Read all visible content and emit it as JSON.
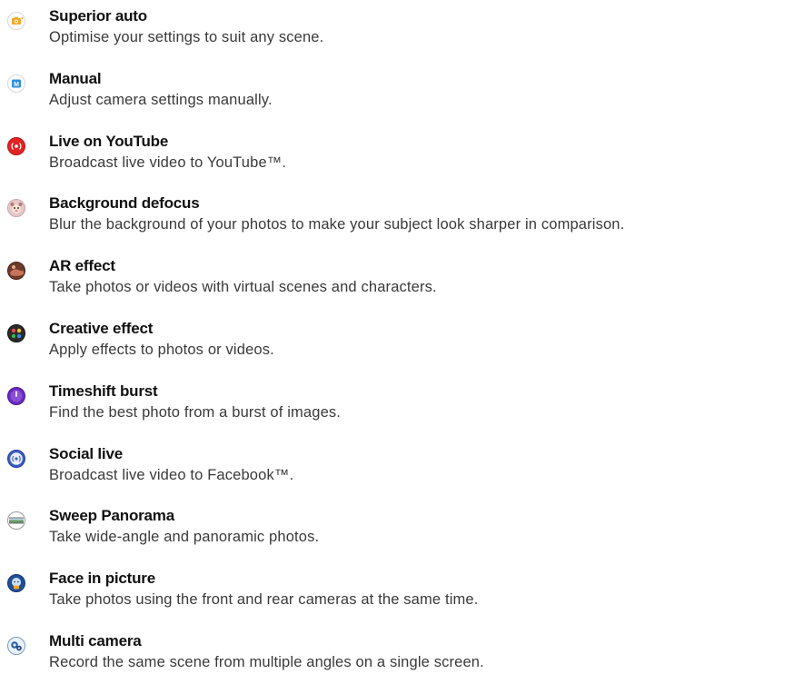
{
  "modes": [
    {
      "title": "Superior auto",
      "description": "Optimise your settings to suit any scene.",
      "icon": "superior-auto-icon"
    },
    {
      "title": "Manual",
      "description": "Adjust camera settings manually.",
      "icon": "manual-icon"
    },
    {
      "title": "Live on YouTube",
      "description": "Broadcast live video to YouTube™.",
      "icon": "youtube-live-icon"
    },
    {
      "title": "Background defocus",
      "description": "Blur the background of your photos to make your subject look sharper in comparison.",
      "icon": "background-defocus-icon"
    },
    {
      "title": "AR effect",
      "description": "Take photos or videos with virtual scenes and characters.",
      "icon": "ar-effect-icon"
    },
    {
      "title": "Creative effect",
      "description": "Apply effects to photos or videos.",
      "icon": "creative-effect-icon"
    },
    {
      "title": "Timeshift burst",
      "description": "Find the best photo from a burst of images.",
      "icon": "timeshift-burst-icon"
    },
    {
      "title": "Social live",
      "description": "Broadcast live video to Facebook™.",
      "icon": "social-live-icon"
    },
    {
      "title": "Sweep Panorama",
      "description": "Take wide-angle and panoramic photos.",
      "icon": "sweep-panorama-icon"
    },
    {
      "title": "Face in picture",
      "description": "Take photos using the front and rear cameras at the same time.",
      "icon": "face-in-picture-icon"
    },
    {
      "title": "Multi camera",
      "description": "Record the same scene from multiple angles on a single screen.",
      "icon": "multi-camera-icon"
    }
  ],
  "colors": {
    "superior_auto": "#f5a623",
    "manual": "#2f8fe0",
    "youtube_live": "#e02424",
    "timeshift": "#6a2bbf",
    "social_live": "#3b5bc4"
  }
}
